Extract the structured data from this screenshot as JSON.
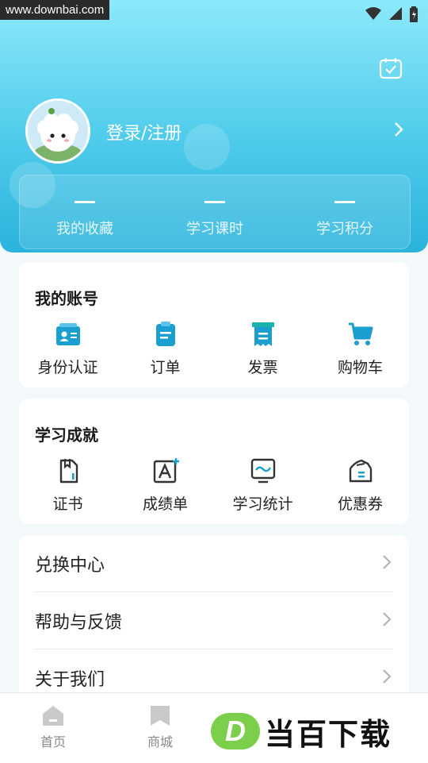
{
  "status_bar": {
    "watermark": "www.downbai.com"
  },
  "profile": {
    "login_label": "登录/注册"
  },
  "stats": [
    {
      "value": "—",
      "label": "我的收藏"
    },
    {
      "value": "—",
      "label": "学习课时"
    },
    {
      "value": "—",
      "label": "学习积分"
    }
  ],
  "account_section": {
    "title": "我的账号",
    "items": [
      {
        "icon": "id-card-icon",
        "label": "身份认证"
      },
      {
        "icon": "order-icon",
        "label": "订单"
      },
      {
        "icon": "invoice-icon",
        "label": "发票"
      },
      {
        "icon": "cart-icon",
        "label": "购物车"
      }
    ]
  },
  "achievement_section": {
    "title": "学习成就",
    "items": [
      {
        "icon": "certificate-icon",
        "label": "证书"
      },
      {
        "icon": "report-card-icon",
        "label": "成绩单"
      },
      {
        "icon": "statistics-icon",
        "label": "学习统计"
      },
      {
        "icon": "coupon-icon",
        "label": "优惠券"
      }
    ]
  },
  "menu": [
    {
      "label": "兑换中心"
    },
    {
      "label": "帮助与反馈"
    },
    {
      "label": "关于我们"
    }
  ],
  "tabbar": [
    {
      "icon": "home-icon",
      "label": "首页"
    },
    {
      "icon": "store-icon",
      "label": "商城"
    }
  ],
  "watermark_brand": {
    "logo_letter": "D",
    "text": "当百下载"
  },
  "colors": {
    "accent": "#1a9fd0",
    "header_top": "#8ce9fa",
    "header_bottom": "#2ab3dc"
  }
}
